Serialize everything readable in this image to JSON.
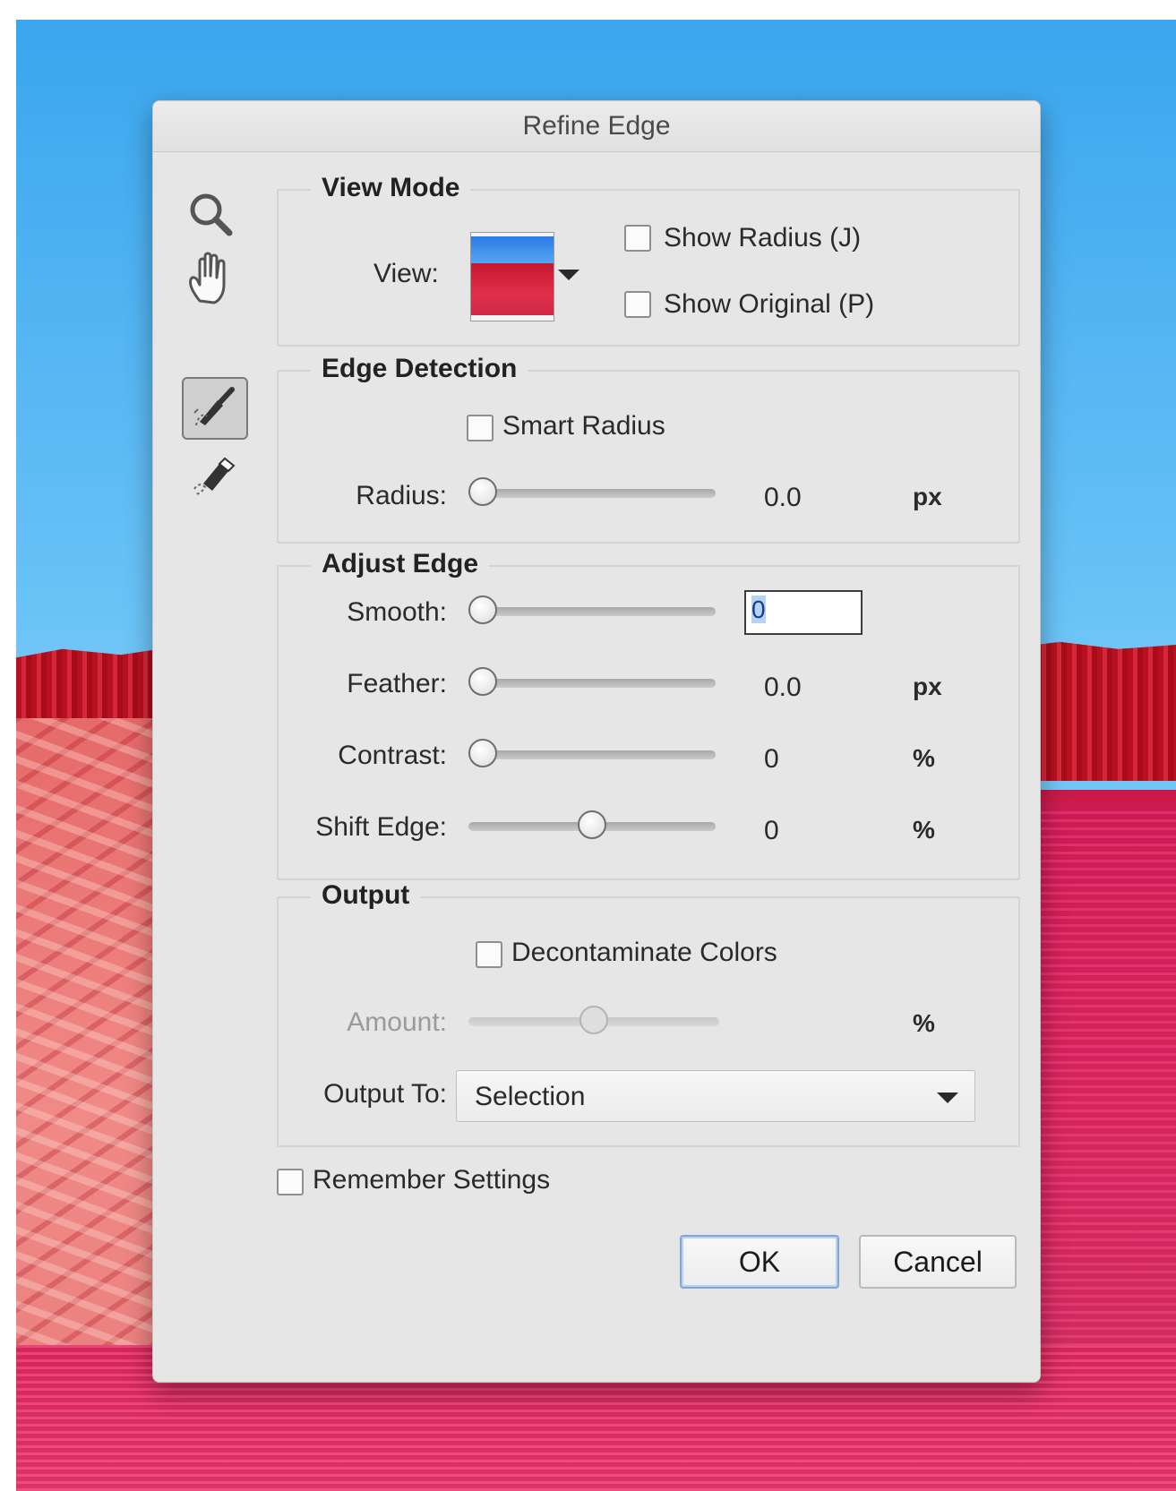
{
  "dialog": {
    "title": "Refine Edge"
  },
  "tools": [
    "zoom-tool",
    "hand-tool",
    "refine-radius-tool",
    "erase-refinements-tool"
  ],
  "view_mode": {
    "legend": "View Mode",
    "view_label": "View:",
    "show_radius": {
      "label": "Show Radius (J)",
      "checked": false
    },
    "show_original": {
      "label": "Show Original (P)",
      "checked": false
    }
  },
  "edge_detection": {
    "legend": "Edge Detection",
    "smart_radius": {
      "label": "Smart Radius",
      "checked": false
    },
    "radius": {
      "label": "Radius:",
      "value": "0.0",
      "unit": "px",
      "position": 0
    }
  },
  "adjust_edge": {
    "legend": "Adjust Edge",
    "smooth": {
      "label": "Smooth:",
      "value": "0",
      "position": 0
    },
    "feather": {
      "label": "Feather:",
      "value": "0.0",
      "unit": "px",
      "position": 0
    },
    "contrast": {
      "label": "Contrast:",
      "value": "0",
      "unit": "%",
      "position": 0
    },
    "shift_edge": {
      "label": "Shift Edge:",
      "value": "0",
      "unit": "%",
      "position": 0.5
    }
  },
  "output": {
    "legend": "Output",
    "decontaminate": {
      "label": "Decontaminate Colors",
      "checked": false
    },
    "amount": {
      "label": "Amount:",
      "unit": "%",
      "position": 0.5,
      "enabled": false
    },
    "output_to": {
      "label": "Output To:",
      "value": "Selection"
    }
  },
  "remember_settings": {
    "label": "Remember Settings",
    "checked": false
  },
  "buttons": {
    "ok": "OK",
    "cancel": "Cancel"
  }
}
